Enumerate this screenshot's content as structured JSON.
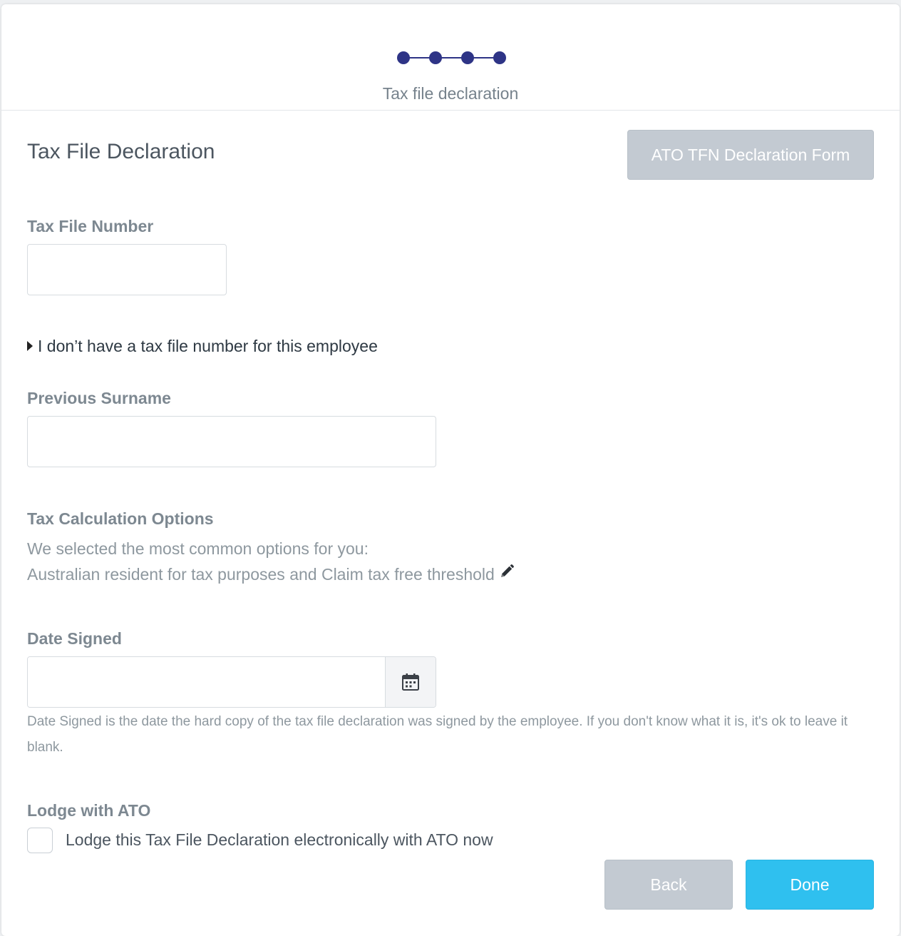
{
  "stepper": {
    "steps_total": 4,
    "current_step_label": "Tax file declaration"
  },
  "header": {
    "title": "Tax File Declaration",
    "ato_button_label": "ATO TFN Declaration Form"
  },
  "form": {
    "tfn": {
      "label": "Tax File Number",
      "value": ""
    },
    "no_tfn_toggle": "I don’t have a tax file number for this employee",
    "previous_surname": {
      "label": "Previous Surname",
      "value": ""
    },
    "tax_calculation": {
      "label": "Tax Calculation Options",
      "intro": "We selected the most common options for you:",
      "summary": "Australian resident for tax purposes and Claim tax free threshold"
    },
    "date_signed": {
      "label": "Date Signed",
      "value": "",
      "help": "Date Signed is the date the hard copy of the tax file declaration was signed by the employee. If you don't know what it is, it's ok to leave it blank."
    },
    "lodge": {
      "label": "Lodge with ATO",
      "checkbox_label": "Lodge this Tax File Declaration electronically with ATO now",
      "checked": false
    }
  },
  "footer": {
    "back_label": "Back",
    "done_label": "Done"
  },
  "colors": {
    "stepper": "#2e3486",
    "primary_button": "#2fc0ef",
    "disabled_button": "#c3cad2"
  },
  "icons": {
    "edit": "pencil-icon",
    "calendar": "calendar-icon",
    "expand": "caret-right-icon"
  }
}
